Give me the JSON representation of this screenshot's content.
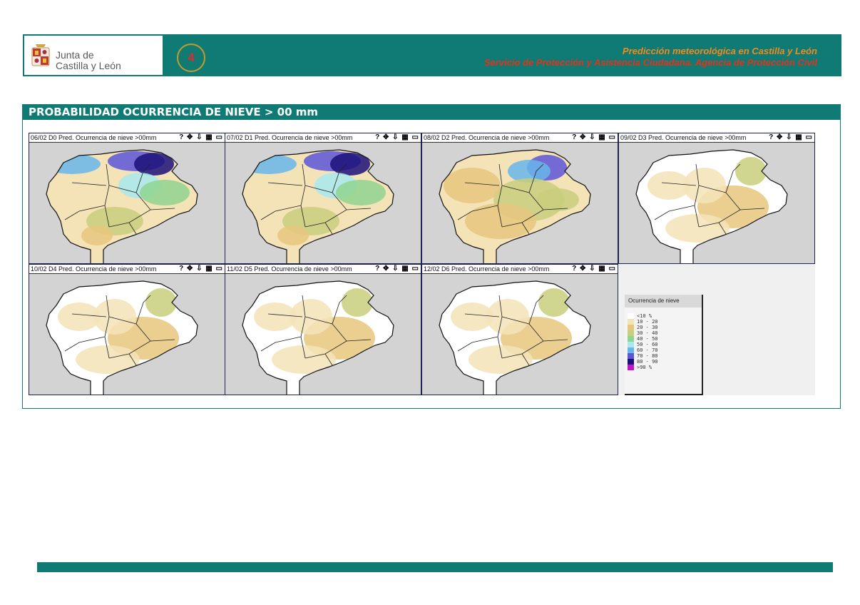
{
  "header": {
    "logo_line1": "Junta de",
    "logo_line2": "Castilla y León",
    "page_number": "4",
    "title": "Predicción meteorológica en Castilla y León",
    "subtitle": "Servicio de Protección y Asistencia Ciudadana. Agencia de Protección Civil"
  },
  "section": {
    "title": "PROBABILIDAD OCURRENCIA DE NIEVE > 00 mm"
  },
  "maps": [
    {
      "label": "06/02 D0 Pred. Ocurrencia de nieve >00mm",
      "tools": "? ✥ ⇩ ▦ ▭",
      "intensity": 3
    },
    {
      "label": "07/02 D1 Pred. Ocurrencia de nieve >00mm",
      "tools": "? ✥ ⇩ ▦ ▭",
      "intensity": 3
    },
    {
      "label": "08/02 D2 Pred. Ocurrencia de nieve >00mm",
      "tools": "? ✥ ⇩ ▦ ▭",
      "intensity": 2
    },
    {
      "label": "09/02 D3 Pred. Ocurrencia de nieve >00mm",
      "tools": "? ✥ ⇩ ▦ ▭",
      "intensity": 1
    },
    {
      "label": "10/02 D4 Pred. Ocurrencia de nieve >00mm",
      "tools": "? ✥ ⇩ ▦ ▭",
      "intensity": 1
    },
    {
      "label": "11/02 D5 Pred. Ocurrencia de nieve >00mm",
      "tools": "? ✥ ⇩ ▦ ▭",
      "intensity": 1
    },
    {
      "label": "12/02 D6 Pred. Ocurrencia de nieve >00mm",
      "tools": "? ✥ ⇩ ▦ ▭",
      "intensity": 1
    }
  ],
  "legend": {
    "title": "Ocurrencia de nieve",
    "items": [
      {
        "label": "<10  %",
        "color": "#ffffff"
      },
      {
        "label": "10 - 20",
        "color": "#f5e3b8"
      },
      {
        "label": "20 - 30",
        "color": "#e6c77e"
      },
      {
        "label": "30 - 40",
        "color": "#c8cf7c"
      },
      {
        "label": "40 - 50",
        "color": "#8fd48f"
      },
      {
        "label": "50 - 60",
        "color": "#a7e9ee"
      },
      {
        "label": "60 - 70",
        "color": "#69b6ea"
      },
      {
        "label": "70 - 80",
        "color": "#5c55d8"
      },
      {
        "label": "80 - 90",
        "color": "#1c1178"
      },
      {
        "label": ">90  %",
        "color": "#c016c8"
      }
    ]
  }
}
